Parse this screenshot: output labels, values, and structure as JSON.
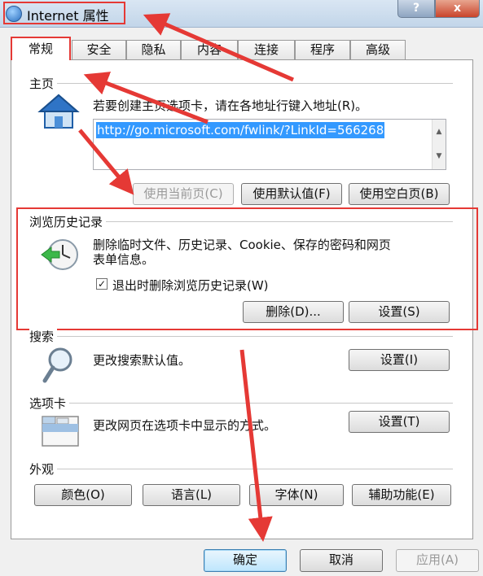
{
  "window": {
    "title": "Internet 属性",
    "help_label": "?",
    "close_label": "x"
  },
  "tabs": [
    {
      "label": "常规"
    },
    {
      "label": "安全"
    },
    {
      "label": "隐私"
    },
    {
      "label": "内容"
    },
    {
      "label": "连接"
    },
    {
      "label": "程序"
    },
    {
      "label": "高级"
    }
  ],
  "home": {
    "title": "主页",
    "description": "若要创建主页选项卡，请在各地址行键入地址(R)。",
    "url": "http://go.microsoft.com/fwlink/?LinkId=566268",
    "buttons": {
      "use_current": "使用当前页(C)",
      "use_default": "使用默认值(F)",
      "use_blank": "使用空白页(B)"
    }
  },
  "history": {
    "title": "浏览历史记录",
    "description_line1": "删除临时文件、历史记录、Cookie、保存的密码和网页",
    "description_line2": "表单信息。",
    "checkbox_label": "退出时删除浏览历史记录(W)",
    "checkbox_checked": true,
    "delete_button": "删除(D)...",
    "settings_button": "设置(S)"
  },
  "search": {
    "title": "搜索",
    "description": "更改搜索默认值。",
    "settings_button": "设置(I)"
  },
  "tabs_group": {
    "title": "选项卡",
    "description": "更改网页在选项卡中显示的方式。",
    "settings_button": "设置(T)"
  },
  "appearance": {
    "title": "外观",
    "buttons": {
      "colors": "颜色(O)",
      "languages": "语言(L)",
      "fonts": "字体(N)",
      "accessibility": "辅助功能(E)"
    }
  },
  "footer": {
    "ok": "确定",
    "cancel": "取消",
    "apply": "应用(A)"
  },
  "annotation_color": "#e53935"
}
